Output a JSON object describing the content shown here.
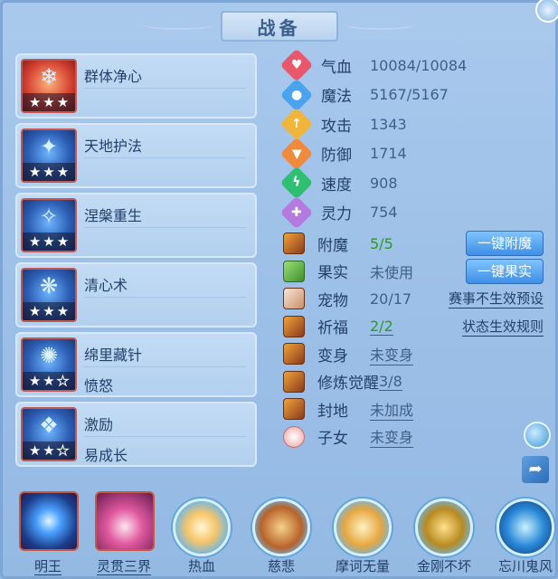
{
  "title": "战备",
  "skills": [
    {
      "name": "群体净心",
      "sub": "",
      "stars": [
        true,
        true,
        true
      ],
      "icon": "purify-skill-icon",
      "tone": "red"
    },
    {
      "name": "天地护法",
      "sub": "",
      "stars": [
        true,
        true,
        true
      ],
      "icon": "guardian-skill-icon",
      "tone": "blue"
    },
    {
      "name": "涅槃重生",
      "sub": "",
      "stars": [
        true,
        true,
        true
      ],
      "icon": "rebirth-skill-icon",
      "tone": "blue"
    },
    {
      "name": "清心术",
      "sub": "",
      "stars": [
        true,
        true,
        true
      ],
      "icon": "clear-mind-skill-icon",
      "tone": "blue"
    },
    {
      "name": "绵里藏针",
      "sub": "愤怒",
      "stars": [
        true,
        true,
        false
      ],
      "icon": "needle-skill-icon",
      "tone": "blue"
    },
    {
      "name": "激励",
      "sub": "易成长",
      "stars": [
        true,
        true,
        false
      ],
      "icon": "inspire-skill-icon",
      "tone": "blue"
    }
  ],
  "stats": [
    {
      "label": "气血",
      "value": "10084/10084",
      "icon": "heart-icon",
      "color": "#e8576b"
    },
    {
      "label": "魔法",
      "value": "5167/5167",
      "icon": "mana-icon",
      "color": "#4aa3ef"
    },
    {
      "label": "攻击",
      "value": "1343",
      "icon": "sword-icon",
      "color": "#f2b53c"
    },
    {
      "label": "防御",
      "value": "1714",
      "icon": "shield-icon",
      "color": "#f08a3c"
    },
    {
      "label": "速度",
      "value": "908",
      "icon": "speed-icon",
      "color": "#2fbf72"
    },
    {
      "label": "灵力",
      "value": "754",
      "icon": "spirit-icon",
      "color": "#b47ae0"
    }
  ],
  "extras": [
    {
      "label": "附魔",
      "value": "5/5",
      "icon": "enchant-icon",
      "value_style": "green",
      "action": "一键附魔"
    },
    {
      "label": "果实",
      "value": "未使用",
      "icon": "fruit-icon",
      "value_style": "",
      "action": "一键果实"
    },
    {
      "label": "宠物",
      "value": "20/17",
      "icon": "pet-icon",
      "value_style": "",
      "link": "赛事不生效预设"
    },
    {
      "label": "祈福",
      "value": "2/2",
      "icon": "blessing-icon",
      "value_style": "green-underline",
      "link": "状态生效规则"
    },
    {
      "label": "变身",
      "value": "未变身",
      "icon": "transform-icon",
      "value_style": "underline"
    },
    {
      "label": "修炼觉醒",
      "value": "3/8",
      "icon": "cultivation-icon",
      "value_style": "underline"
    },
    {
      "label": "封地",
      "value": "未加成",
      "icon": "fief-icon",
      "value_style": "underline"
    },
    {
      "label": "子女",
      "value": "未变身",
      "icon": "child-icon",
      "value_style": "underline"
    }
  ],
  "bottom": [
    {
      "label": "明王",
      "shape": "square",
      "underline": true,
      "icon": "light-orb-icon"
    },
    {
      "label": "灵贯三界",
      "shape": "square",
      "underline": true,
      "icon": "buddha-icon"
    },
    {
      "label": "热血",
      "shape": "circle",
      "underline": false,
      "icon": "monk-icon"
    },
    {
      "label": "慈悲",
      "shape": "circle",
      "underline": false,
      "icon": "treasure-chest-icon"
    },
    {
      "label": "摩诃无量",
      "shape": "circle",
      "underline": false,
      "icon": "sage-icon"
    },
    {
      "label": "金刚不坏",
      "shape": "circle",
      "underline": false,
      "icon": "golden-warrior-icon"
    },
    {
      "label": "忘川鬼风",
      "shape": "circle",
      "underline": false,
      "icon": "ghost-wind-icon"
    }
  ]
}
